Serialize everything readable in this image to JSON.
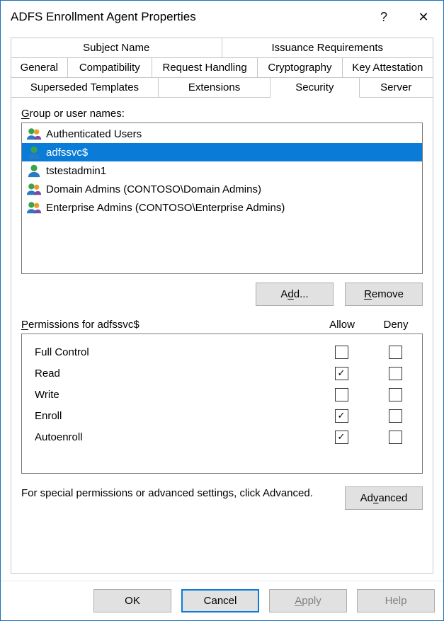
{
  "window": {
    "title": "ADFS Enrollment Agent Properties",
    "help_btn": "?",
    "close_btn": "✕"
  },
  "tabs": {
    "row1": [
      "Subject Name",
      "Issuance Requirements"
    ],
    "row2": [
      "General",
      "Compatibility",
      "Request Handling",
      "Cryptography",
      "Key Attestation"
    ],
    "row3": [
      "Superseded Templates",
      "Extensions",
      "Security",
      "Server"
    ],
    "active": "Security"
  },
  "security": {
    "group_label": "Group or user names:",
    "list": [
      {
        "name": "Authenticated Users",
        "icon": "group",
        "selected": false
      },
      {
        "name": "adfssvc$",
        "icon": "user",
        "selected": true
      },
      {
        "name": "tstestadmin1",
        "icon": "user",
        "selected": false
      },
      {
        "name": "Domain Admins (CONTOSO\\Domain Admins)",
        "icon": "group",
        "selected": false
      },
      {
        "name": "Enterprise Admins (CONTOSO\\Enterprise Admins)",
        "icon": "group",
        "selected": false
      }
    ],
    "add_btn": "Add...",
    "remove_btn": "Remove",
    "perm_label_prefix": "Permissions for ",
    "perm_label_subject": "adfssvc$",
    "col_allow": "Allow",
    "col_deny": "Deny",
    "permissions": [
      {
        "name": "Full Control",
        "allow": false,
        "deny": false
      },
      {
        "name": "Read",
        "allow": true,
        "deny": false
      },
      {
        "name": "Write",
        "allow": false,
        "deny": false
      },
      {
        "name": "Enroll",
        "allow": true,
        "deny": false
      },
      {
        "name": "Autoenroll",
        "allow": true,
        "deny": false
      }
    ],
    "advanced_text": "For special permissions or advanced settings, click Advanced.",
    "advanced_btn": "Advanced"
  },
  "footer": {
    "ok": "OK",
    "cancel": "Cancel",
    "apply": "Apply",
    "help": "Help"
  }
}
